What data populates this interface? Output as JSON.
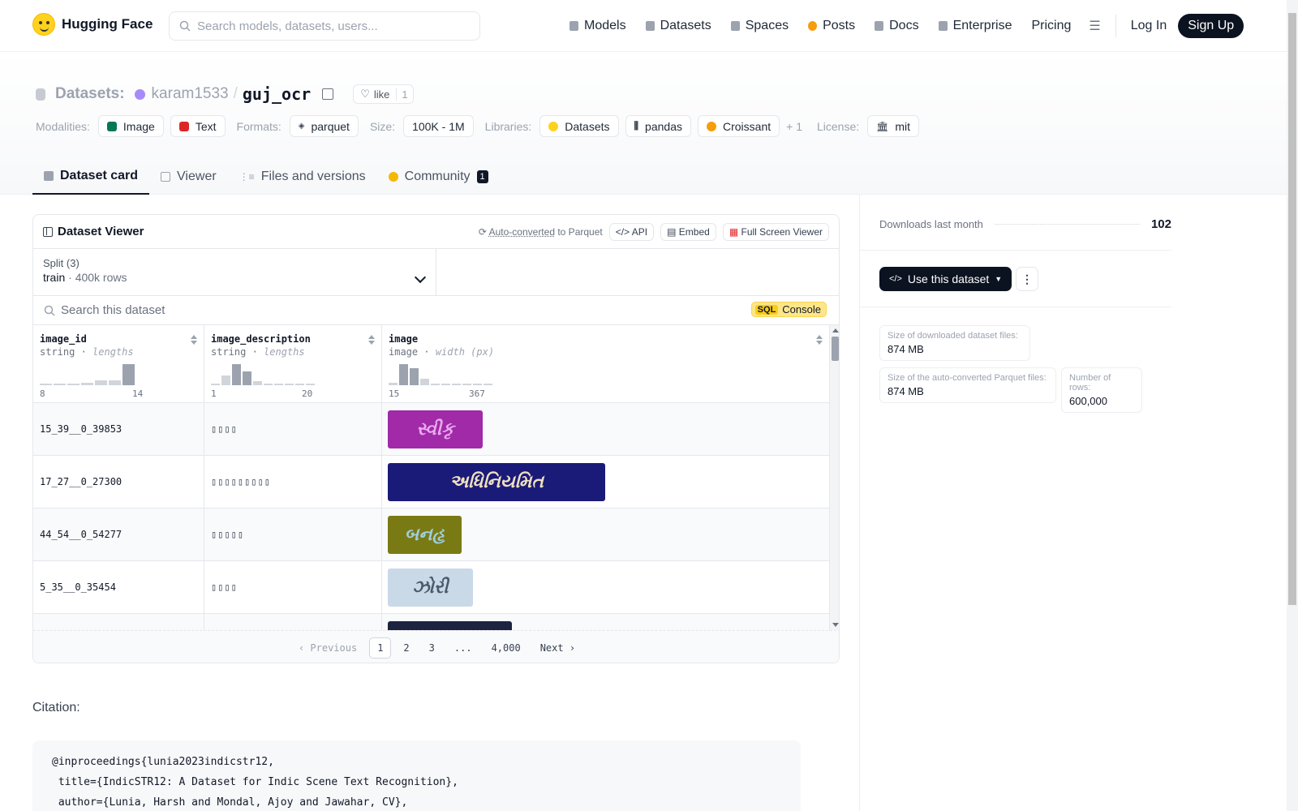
{
  "nav": {
    "brand": "Hugging Face",
    "search_placeholder": "Search models, datasets, users...",
    "links": [
      "Models",
      "Datasets",
      "Spaces",
      "Posts",
      "Docs",
      "Enterprise",
      "Pricing"
    ],
    "login": "Log In",
    "signup": "Sign Up"
  },
  "header": {
    "section": "Datasets:",
    "owner": "karam1533",
    "name": "guj_ocr",
    "like_label": "like",
    "like_count": "1"
  },
  "tags": {
    "modalities_label": "Modalities:",
    "modalities": [
      "Image",
      "Text"
    ],
    "formats_label": "Formats:",
    "formats": [
      "parquet"
    ],
    "size_label": "Size:",
    "size": "100K - 1M",
    "libraries_label": "Libraries:",
    "libraries": [
      "Datasets",
      "pandas",
      "Croissant"
    ],
    "libraries_more": "+ 1",
    "license_label": "License:",
    "license": "mit"
  },
  "tabs": [
    {
      "label": "Dataset card"
    },
    {
      "label": "Viewer"
    },
    {
      "label": "Files and versions"
    },
    {
      "label": "Community",
      "badge": "1"
    }
  ],
  "viewer": {
    "title": "Dataset Viewer",
    "auto_converted": "Auto-converted",
    "to_parquet": "to Parquet",
    "api": "API",
    "embed": "Embed",
    "full_screen": "Full Screen Viewer",
    "split_label": "Split (3)",
    "split_name": "train",
    "split_rows": "400k rows",
    "search_placeholder": "Search this dataset",
    "sql": "SQL",
    "console": "Console",
    "columns": [
      {
        "name": "image_id",
        "type": "string",
        "stat": "lengths",
        "min": "8",
        "max": "14"
      },
      {
        "name": "image_description",
        "type": "string",
        "stat": "lengths",
        "min": "1",
        "max": "20"
      },
      {
        "name": "image",
        "type": "image",
        "stat": "width (px)",
        "min": "15",
        "max": "367"
      }
    ],
    "rows": [
      {
        "id": "15_39__0_39853",
        "desc": "▯▯▯▯",
        "img_text": "સ્વીકૃ",
        "img_bg": "#a12aa8",
        "img_fg": "#e9a9ef",
        "img_w": 117,
        "img_h": 47
      },
      {
        "id": "17_27__0_27300",
        "desc": "▯▯▯▯▯▯▯▯▯",
        "img_text": "અધિનિયમિત",
        "img_bg": "#1a1a78",
        "img_fg": "#f0e0c0",
        "img_w": 268,
        "img_h": 47
      },
      {
        "id": "44_54__0_54277",
        "desc": "▯▯▯▯▯",
        "img_text": "બનહૃ",
        "img_bg": "#7a7a14",
        "img_fg": "#9ecfe0",
        "img_w": 91,
        "img_h": 47
      },
      {
        "id": "5_35__0_35454",
        "desc": "▯▯▯▯",
        "img_text": "ઝોરી",
        "img_bg": "#c9d9e8",
        "img_fg": "#4a5a6a",
        "img_w": 105,
        "img_h": 47
      },
      {
        "id": "",
        "desc": "",
        "img_text": "",
        "img_bg": "#1d2440",
        "img_fg": "#c0406a",
        "img_w": 153,
        "img_h": 47
      }
    ],
    "pager": {
      "prev": "Previous",
      "pages": [
        "1",
        "2",
        "3",
        "...",
        "4,000"
      ],
      "next": "Next"
    }
  },
  "citation": {
    "label": "Citation:",
    "lines": [
      "@inproceedings{lunia2023indicstr12,",
      " title={IndicSTR12: A Dataset for Indic Scene Text Recognition},",
      " author={Lunia, Harsh and Mondal, Ajoy and Jawahar, CV},"
    ]
  },
  "side": {
    "downloads_label": "Downloads last month",
    "downloads": "102",
    "use_dataset": "Use this dataset",
    "size_download_label": "Size of downloaded dataset files:",
    "size_download": "874 MB",
    "size_parquet_label": "Size of the auto-converted Parquet files:",
    "size_parquet": "874 MB",
    "rows_label": "Number of rows:",
    "rows": "600,000"
  },
  "histograms": {
    "image_id": [
      0.05,
      0.05,
      0.05,
      0.1,
      0.2,
      0.2,
      0.85
    ],
    "image_description": [
      0.05,
      0.4,
      0.85,
      0.55,
      0.15,
      0.05,
      0.05,
      0.05,
      0.05,
      0.05
    ],
    "image": [
      0.1,
      0.85,
      0.7,
      0.25,
      0.05,
      0.05,
      0.05,
      0.05,
      0.05,
      0.05
    ]
  }
}
